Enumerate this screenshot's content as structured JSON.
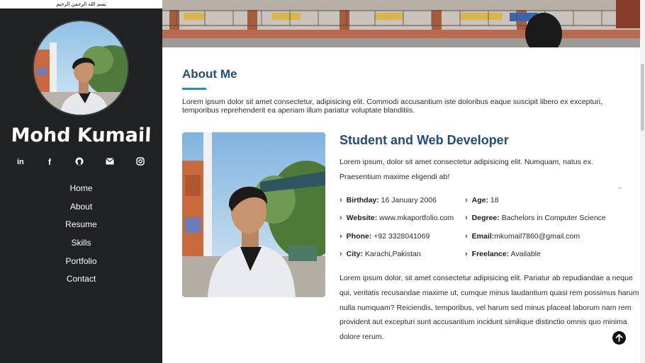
{
  "sidebar": {
    "bismillah": "بسم الله الرحمن الرحيم",
    "name": "Mohd Kumail",
    "socials": [
      {
        "icon": "linkedin-icon",
        "label": "in"
      },
      {
        "icon": "facebook-icon",
        "label": "f"
      },
      {
        "icon": "github-icon",
        "label": ""
      },
      {
        "icon": "email-icon",
        "label": ""
      },
      {
        "icon": "instagram-icon",
        "label": ""
      }
    ],
    "nav": [
      "Home",
      "About",
      "Resume",
      "Skills",
      "Portfolio",
      "Contact"
    ]
  },
  "about": {
    "title": "About Me",
    "intro": "Lorem ipsum dolor sit amet consectetur, adipisicing elit. Commodi accusantium iste doloribus eaque suscipit libero ex excepturi, temporibus reprehenderit ea aperiam illum pariatur voluptate blanditiis.",
    "role_title": "Student and Web Developer",
    "role_desc": "Lorem ipsum, dolor sit amet consectetur adipisicing elit. Numquam, natus ex. Praesentium maxime eligendi ab!",
    "dots": "..",
    "facts": [
      {
        "label": "Birthday:",
        "value": " 16 January 2006"
      },
      {
        "label": "Age:",
        "value": " 18"
      },
      {
        "label": "Website:",
        "value": " www.mkaportfolio.com"
      },
      {
        "label": "Degree:",
        "value": " Bachelors in Computer Science"
      },
      {
        "label": "Phone:",
        "value": " +92 3328041069"
      },
      {
        "label": "Email:",
        "value": "mkumail7860@gmail.com"
      },
      {
        "label": "City:",
        "value": " Karachi,Pakistan"
      },
      {
        "label": "Freelance:",
        "value": " Available"
      }
    ],
    "long_text": "Lorem ipsum dolor, sit amet consectetur adipisicing elit. Pariatur ab repudiandae a neque qui, veritatis recusandae maxime ut, cumque minus laudantium quasi rem possimus harum nulla numquam? Reiciendis, temporibus, vel harum sed minus placeat laborum nam rem provident aut excepturi sunt accusantium incidunt similique distinctio omnis quo minima dolore rerum."
  },
  "colors": {
    "sidebar_bg": "#202123",
    "heading": "#1f4e79",
    "accent": "#1a8fd4"
  }
}
